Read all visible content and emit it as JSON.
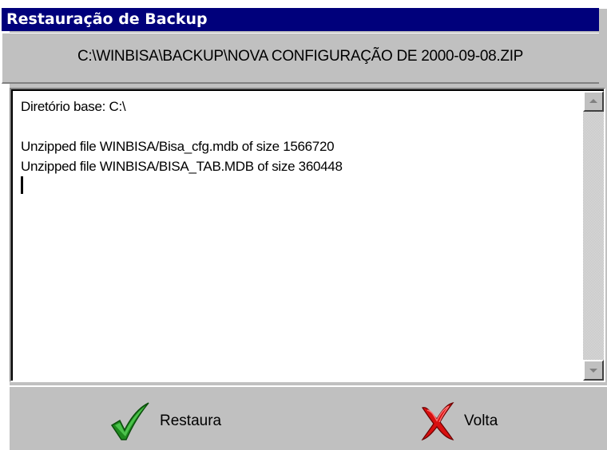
{
  "window": {
    "title": "Restauração de Backup"
  },
  "path_bar": {
    "text": "C:\\WINBISA\\BACKUP\\NOVA CONFIGURAÇÃO DE 2000-09-08.ZIP"
  },
  "log": {
    "lines": [
      "Diretório base: C:\\",
      "",
      "Unzipped file WINBISA/Bisa_cfg.mdb of size 1566720",
      "Unzipped file WINBISA/BISA_TAB.MDB of size 360448"
    ]
  },
  "buttons": {
    "restaura": {
      "label": "Restaura",
      "icon": "green-checkmark-icon",
      "color": "#2e9a2e"
    },
    "volta": {
      "label": "Volta",
      "icon": "red-x-icon",
      "color": "#e01010"
    }
  },
  "colors": {
    "titlebar": "#00007b",
    "face": "#c0c0c0"
  }
}
